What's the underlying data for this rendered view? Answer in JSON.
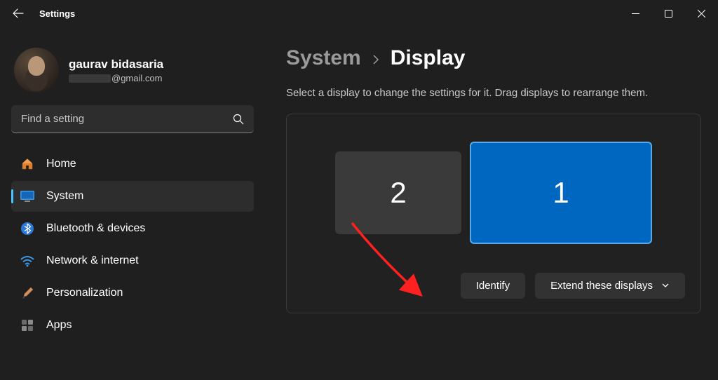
{
  "window": {
    "title": "Settings"
  },
  "user": {
    "name": "gaurav bidasaria",
    "email_suffix": "@gmail.com"
  },
  "search": {
    "placeholder": "Find a setting"
  },
  "nav": [
    {
      "label": "Home",
      "icon": "home"
    },
    {
      "label": "System",
      "icon": "system",
      "active": true
    },
    {
      "label": "Bluetooth & devices",
      "icon": "bluetooth"
    },
    {
      "label": "Network & internet",
      "icon": "wifi"
    },
    {
      "label": "Personalization",
      "icon": "brush"
    },
    {
      "label": "Apps",
      "icon": "apps"
    }
  ],
  "breadcrumb": {
    "parent": "System",
    "current": "Display"
  },
  "description": "Select a display to change the settings for it. Drag displays to rearrange them.",
  "monitors": {
    "m1": "1",
    "m2": "2"
  },
  "actions": {
    "identify": "Identify",
    "extend": "Extend these displays"
  }
}
